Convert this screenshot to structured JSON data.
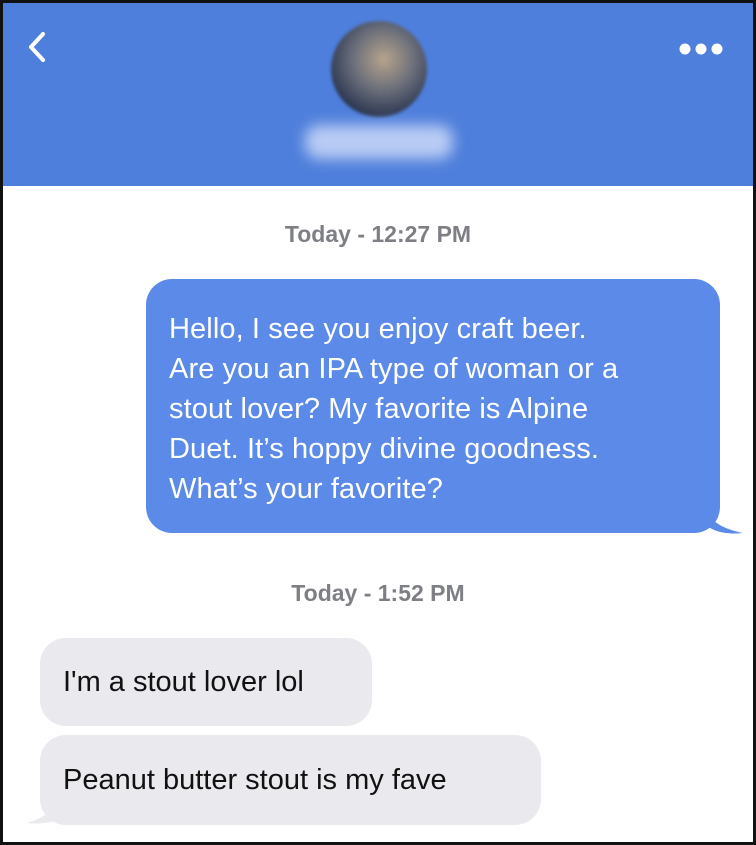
{
  "header": {
    "back_icon": "chevron-left-icon",
    "more_icon": "more-horizontal-icon",
    "contact_name": "",
    "accent_color": "#4f7fdc"
  },
  "messages": [
    {
      "type": "timestamp",
      "text": "Today - 12:27 PM"
    },
    {
      "type": "outgoing",
      "lines": [
        "Hello, I see you enjoy craft beer.",
        "Are you an IPA type of woman or a",
        "stout lover? My favorite is Alpine",
        "Duet. It’s hoppy divine goodness.",
        "What’s your favorite?"
      ]
    },
    {
      "type": "timestamp",
      "text": "Today - 1:52 PM"
    },
    {
      "type": "incoming",
      "text": "I'm a stout lover lol"
    },
    {
      "type": "incoming",
      "text": "Peanut butter stout is my fave"
    }
  ]
}
